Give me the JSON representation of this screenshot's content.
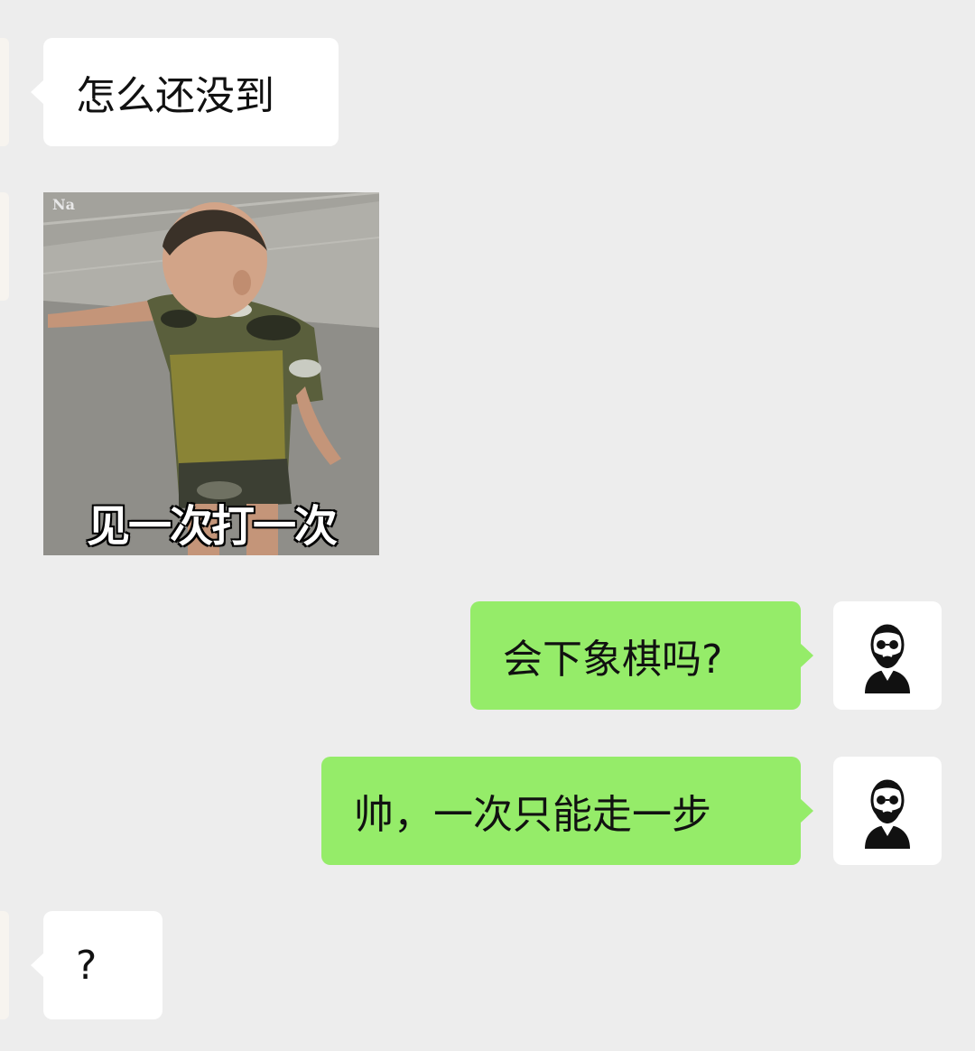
{
  "messages": [
    {
      "side": "incoming",
      "type": "text",
      "text": "怎么还没到"
    },
    {
      "side": "incoming",
      "type": "sticker",
      "watermark": "Na",
      "caption": "见一次打一次"
    },
    {
      "side": "outgoing",
      "type": "text",
      "text": "会下象棋吗?"
    },
    {
      "side": "outgoing",
      "type": "text",
      "text": "帅，一次只能走一步"
    },
    {
      "side": "incoming",
      "type": "text",
      "text": "?"
    }
  ],
  "icons": {
    "self_avatar": "bearded-man-sunglasses-avatar-icon"
  },
  "colors": {
    "background": "#ededed",
    "incoming_bubble": "#ffffff",
    "outgoing_bubble": "#95ec69"
  }
}
